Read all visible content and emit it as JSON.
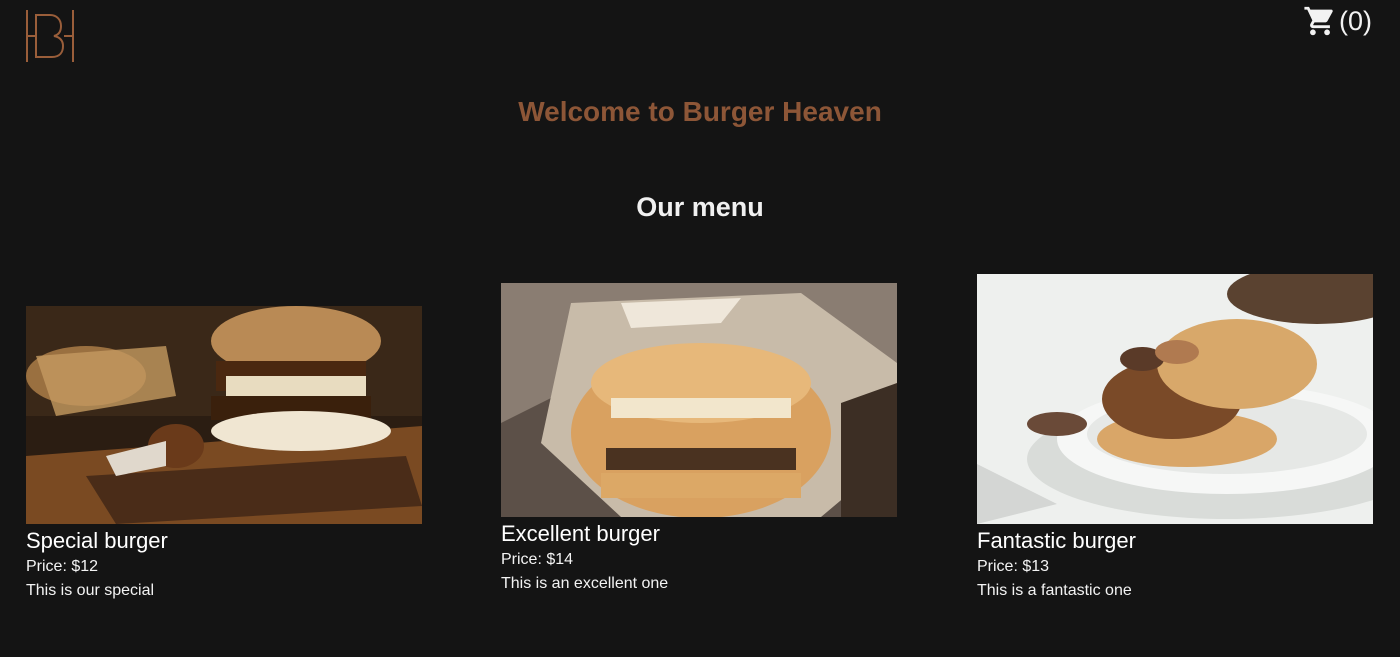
{
  "header": {
    "logo_letter": "B",
    "cart": {
      "count_label": "(0)",
      "icon": "shopping-cart-icon"
    }
  },
  "welcome": "Welcome to Burger Heaven",
  "menu_title": "Our menu",
  "colors": {
    "background": "#141414",
    "accent": "#8d5637",
    "text": "#ffffff"
  },
  "menu": {
    "items": [
      {
        "name": "Special burger",
        "price": "Price: $12",
        "description": "This is our special"
      },
      {
        "name": "Excellent burger",
        "price": "Price: $14",
        "description": "This is an excellent one"
      },
      {
        "name": "Fantastic burger",
        "price": "Price: $13",
        "description": "This is a fantastic one"
      }
    ]
  }
}
